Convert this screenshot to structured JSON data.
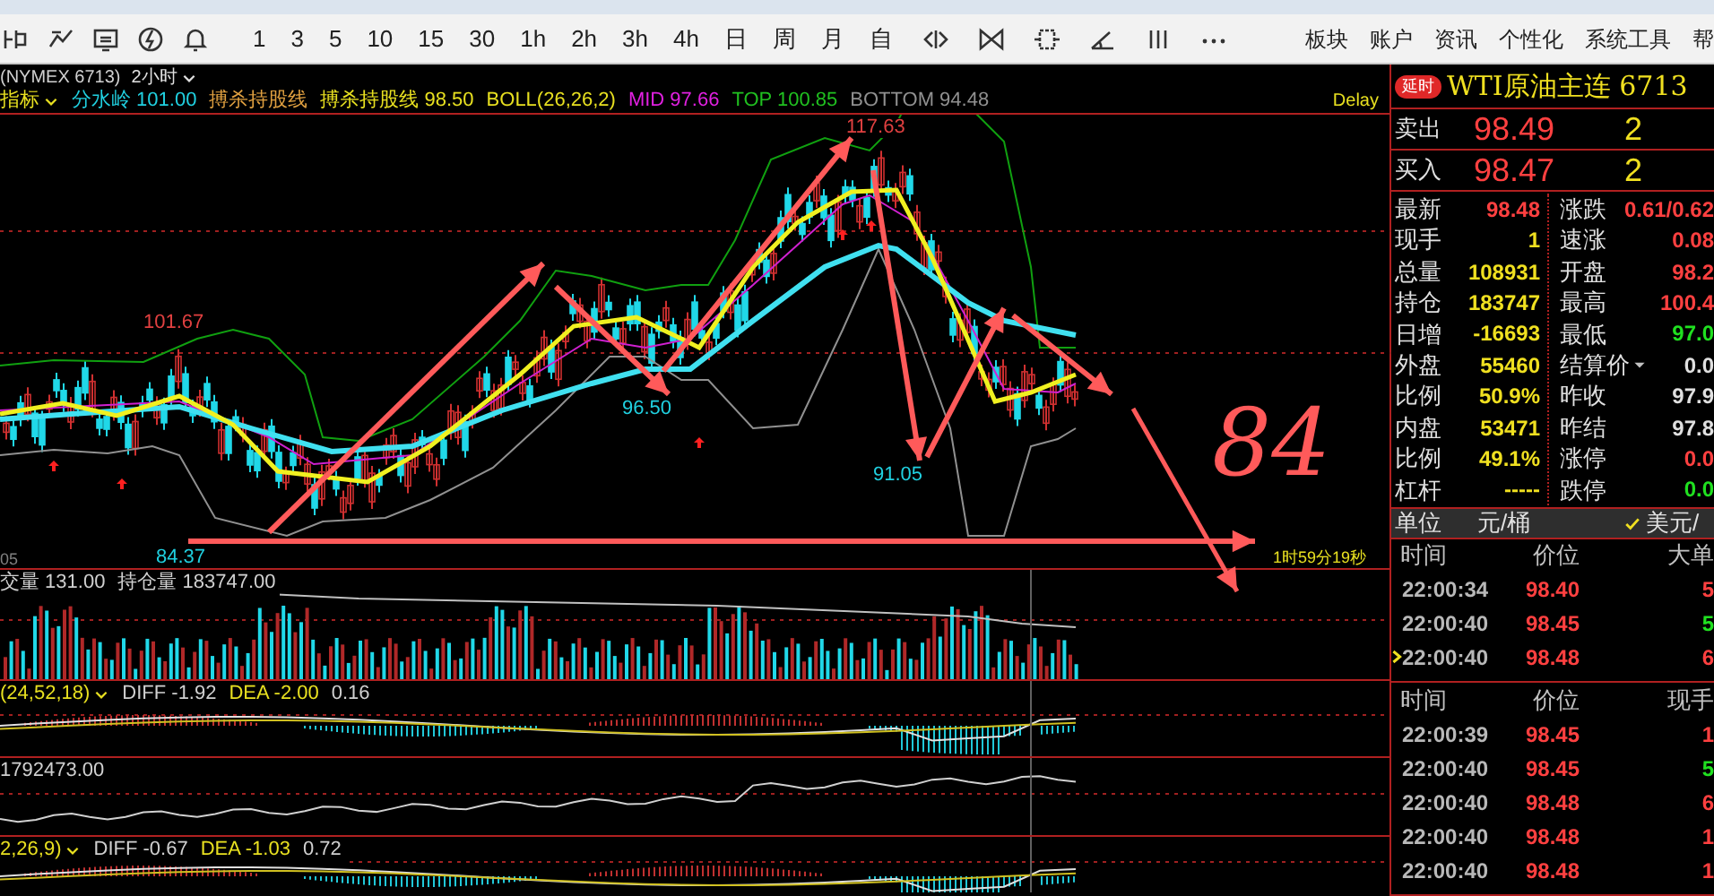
{
  "toolbar": {
    "periods": [
      "1",
      "3",
      "5",
      "10",
      "15",
      "30",
      "1h",
      "2h",
      "3h",
      "4h",
      "日",
      "周",
      "月",
      "自"
    ],
    "menu": [
      "板块",
      "账户",
      "资讯",
      "个性化",
      "系统工具",
      "帮"
    ]
  },
  "chart": {
    "symbol": "(NYMEX 6713)",
    "period": "2小时",
    "indicator_menu": "指标",
    "legend": [
      {
        "text": "分水岭 101.00",
        "color": "#20d0e0"
      },
      {
        "text": "搏杀持股线",
        "color": "#e0a040"
      },
      {
        "text": "搏杀持股线 98.50",
        "color": "#e8e020"
      },
      {
        "text": "BOLL(26,26,2)",
        "color": "#e8e020"
      },
      {
        "text": "MID 97.66",
        "color": "#e020e0"
      },
      {
        "text": "TOP 100.85",
        "color": "#20c020"
      },
      {
        "text": "BOTTOM 94.48",
        "color": "#909090"
      }
    ],
    "delay": "Delay",
    "price_labels": [
      {
        "text": "101.67",
        "color": "#e04040"
      },
      {
        "text": "117.63",
        "color": "#e04040"
      },
      {
        "text": "96.50",
        "color": "#20d0e0"
      },
      {
        "text": "91.05",
        "color": "#20d0e0"
      },
      {
        "text": "84.37",
        "color": "#20d0e0"
      }
    ],
    "axis_label": "05",
    "countdown": "1时59分19秒",
    "annotation": "84"
  },
  "panels": [
    {
      "legend": [
        {
          "text": "交量 131.00",
          "color": "#d0d0d0"
        },
        {
          "text": "持仓量 183747.00",
          "color": "#d0d0d0"
        }
      ]
    },
    {
      "menu": "(24,52,18)",
      "legend": [
        {
          "text": "DIFF -1.92",
          "color": "#d0d0d0"
        },
        {
          "text": "DEA -2.00",
          "color": "#e8e020"
        },
        {
          "text": "0.16",
          "color": "#d0d0d0"
        }
      ]
    },
    {
      "legend": [
        {
          "text": "1792473.00",
          "color": "#d0d0d0"
        }
      ]
    },
    {
      "menu": "2,26,9)",
      "legend": [
        {
          "text": "DIFF -0.67",
          "color": "#d0d0d0"
        },
        {
          "text": "DEA -1.03",
          "color": "#e8e020"
        },
        {
          "text": "0.72",
          "color": "#d0d0d0"
        }
      ]
    }
  ],
  "quote": {
    "badge": "延时",
    "title": "WTI原油主连 6713",
    "orders": [
      {
        "label": "卖出",
        "price": "98.49",
        "volume": "2"
      },
      {
        "label": "买入",
        "price": "98.47",
        "volume": "2"
      }
    ],
    "stats": [
      {
        "label": "最新",
        "value": "98.48",
        "color": "#ff4040"
      },
      {
        "label": "现手",
        "value": "1",
        "color": "#f0e020"
      },
      {
        "label": "总量",
        "value": "108931",
        "color": "#f0e020"
      },
      {
        "label": "持仓",
        "value": "183747",
        "color": "#f0e020"
      },
      {
        "label": "日增",
        "value": "-16693",
        "color": "#f0e020"
      },
      {
        "label": "外盘",
        "value": "55460",
        "color": "#f0e020"
      },
      {
        "label": "比例",
        "value": "50.9%",
        "color": "#f0e020"
      },
      {
        "label": "内盘",
        "value": "53471",
        "color": "#f0e020"
      },
      {
        "label": "比例",
        "value": "49.1%",
        "color": "#f0e020"
      },
      {
        "label": "杠杆",
        "value": "-----",
        "color": "#f0e020"
      }
    ],
    "stats_2": [
      {
        "label": "涨跌",
        "value": "0.61/0.62",
        "color": "#ff4040",
        "dropdown": false
      },
      {
        "label": "速涨",
        "value": "0.08",
        "color": "#ff4040",
        "dropdown": false
      },
      {
        "label": "开盘",
        "value": "98.2",
        "color": "#ff4040",
        "dropdown": false
      },
      {
        "label": "最高",
        "value": "100.4",
        "color": "#ff4040",
        "dropdown": false
      },
      {
        "label": "最低",
        "value": "97.0",
        "color": "#20e020",
        "dropdown": false
      },
      {
        "label": "结算价",
        "value": "0.0",
        "color": "#e0e0e0",
        "dropdown": true
      },
      {
        "label": "昨收",
        "value": "97.9",
        "color": "#e0e0e0",
        "dropdown": false
      },
      {
        "label": "昨结",
        "value": "97.8",
        "color": "#e0e0e0",
        "dropdown": false
      },
      {
        "label": "涨停",
        "value": "0.0",
        "color": "#ff4040",
        "dropdown": false
      },
      {
        "label": "跌停",
        "value": "0.0",
        "color": "#20e020",
        "dropdown": false
      }
    ],
    "unit": {
      "label": "单位",
      "value": "元/桶",
      "option": "美元/",
      "checked": true
    },
    "tables": [
      {
        "columns": [
          "时间",
          "价位",
          "大单"
        ],
        "rows": [
          {
            "time": "22:00:34",
            "price": "98.40",
            "amount": "5",
            "color": "#ff4040",
            "selected": false
          },
          {
            "time": "22:00:40",
            "price": "98.45",
            "amount": "5",
            "color": "#20e020",
            "selected": false
          },
          {
            "time": "22:00:40",
            "price": "98.48",
            "amount": "6",
            "color": "#ff4040",
            "selected": true
          }
        ]
      },
      {
        "columns": [
          "时间",
          "价位",
          "现手"
        ],
        "rows": [
          {
            "time": "22:00:39",
            "price": "98.45",
            "amount": "1",
            "color": "#ff4040",
            "selected": false
          },
          {
            "time": "22:00:40",
            "price": "98.45",
            "amount": "5",
            "color": "#20e020",
            "selected": false
          },
          {
            "time": "22:00:40",
            "price": "98.48",
            "amount": "6",
            "color": "#ff4040",
            "selected": false
          },
          {
            "time": "22:00:40",
            "price": "98.48",
            "amount": "1",
            "color": "#ff4040",
            "selected": false
          },
          {
            "time": "22:00:40",
            "price": "98.48",
            "amount": "1",
            "color": "#ff4040",
            "selected": false
          }
        ]
      }
    ]
  }
}
